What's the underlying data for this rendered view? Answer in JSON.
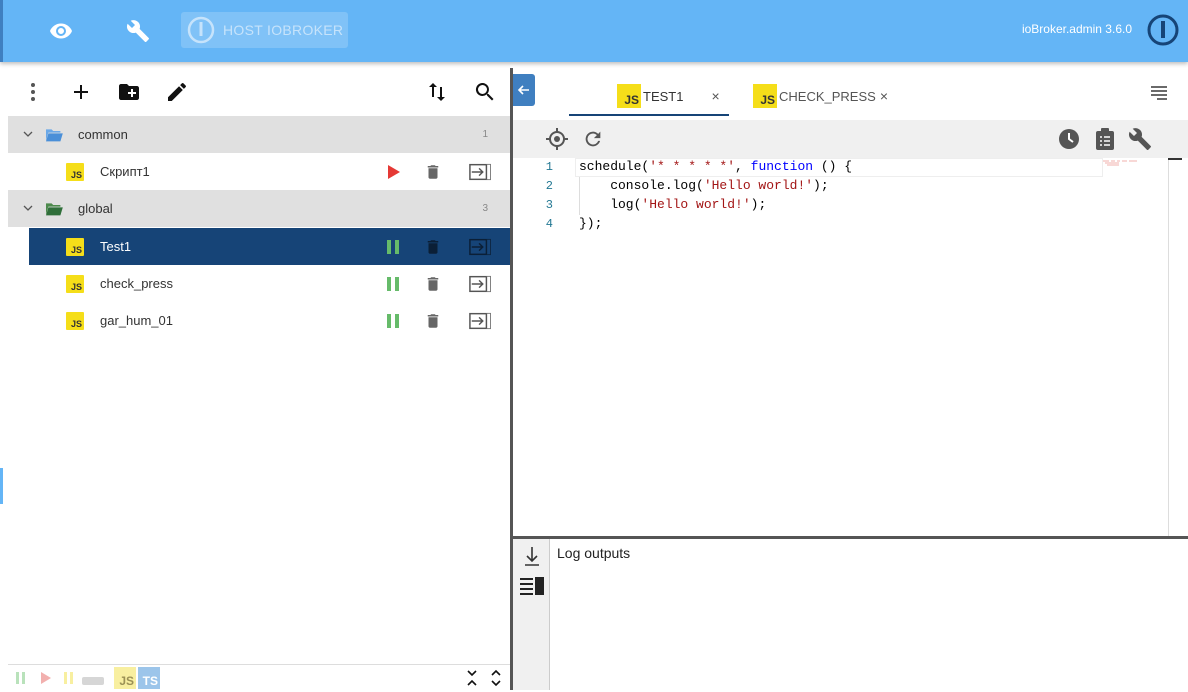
{
  "topbar": {
    "host_label": "HOST IOBROKER",
    "version": "ioBroker.admin 3.6.0"
  },
  "tree": {
    "folders": [
      {
        "name": "common",
        "count": "1"
      },
      {
        "name": "global",
        "count": "3"
      }
    ],
    "scripts": [
      {
        "name": "Скрипт1",
        "folder": "common",
        "status": "stopped"
      },
      {
        "name": "Test1",
        "folder": "global",
        "status": "running",
        "selected": true
      },
      {
        "name": "check_press",
        "folder": "global",
        "status": "running"
      },
      {
        "name": "gar_hum_01",
        "folder": "global",
        "status": "running"
      }
    ],
    "badge_js": "JS"
  },
  "bottom_bar": {
    "js_label": "JS",
    "ts_label": "TS"
  },
  "tabs": [
    {
      "label": "TEST1",
      "close": "×",
      "active": true
    },
    {
      "label": "CHECK_PRESS",
      "close": "×",
      "active": false
    }
  ],
  "tab_badge": "JS",
  "editor": {
    "lines": [
      {
        "num": "1"
      },
      {
        "num": "2"
      },
      {
        "num": "3"
      },
      {
        "num": "4"
      }
    ],
    "code": {
      "l1_fn": "schedule(",
      "l1_str": "'* * * * *'",
      "l1_sep": ", ",
      "l1_kw": "function",
      "l1_rest": " () {",
      "l2_pre": "    console.log(",
      "l2_str": "'Hello world!'",
      "l2_post": ");",
      "l3_pre": "    log(",
      "l3_str": "'Hello world!'",
      "l3_post": ");",
      "l4": "});"
    }
  },
  "log": {
    "title": "Log outputs"
  },
  "colors": {
    "topbar": "#64b5f6",
    "selected_row": "#164477",
    "folder_bg": "#e0e0e0",
    "js_yellow": "#f5de19",
    "running_green": "#66bb6a",
    "stopped_red": "#e53935"
  }
}
